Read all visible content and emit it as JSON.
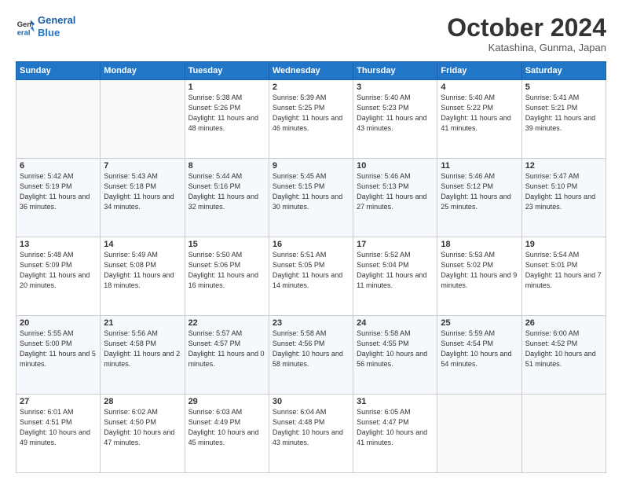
{
  "header": {
    "logo_line1": "General",
    "logo_line2": "Blue",
    "month": "October 2024",
    "location": "Katashina, Gunma, Japan"
  },
  "weekdays": [
    "Sunday",
    "Monday",
    "Tuesday",
    "Wednesday",
    "Thursday",
    "Friday",
    "Saturday"
  ],
  "weeks": [
    [
      {
        "day": "",
        "info": ""
      },
      {
        "day": "",
        "info": ""
      },
      {
        "day": "1",
        "info": "Sunrise: 5:38 AM\nSunset: 5:26 PM\nDaylight: 11 hours and 48 minutes."
      },
      {
        "day": "2",
        "info": "Sunrise: 5:39 AM\nSunset: 5:25 PM\nDaylight: 11 hours and 46 minutes."
      },
      {
        "day": "3",
        "info": "Sunrise: 5:40 AM\nSunset: 5:23 PM\nDaylight: 11 hours and 43 minutes."
      },
      {
        "day": "4",
        "info": "Sunrise: 5:40 AM\nSunset: 5:22 PM\nDaylight: 11 hours and 41 minutes."
      },
      {
        "day": "5",
        "info": "Sunrise: 5:41 AM\nSunset: 5:21 PM\nDaylight: 11 hours and 39 minutes."
      }
    ],
    [
      {
        "day": "6",
        "info": "Sunrise: 5:42 AM\nSunset: 5:19 PM\nDaylight: 11 hours and 36 minutes."
      },
      {
        "day": "7",
        "info": "Sunrise: 5:43 AM\nSunset: 5:18 PM\nDaylight: 11 hours and 34 minutes."
      },
      {
        "day": "8",
        "info": "Sunrise: 5:44 AM\nSunset: 5:16 PM\nDaylight: 11 hours and 32 minutes."
      },
      {
        "day": "9",
        "info": "Sunrise: 5:45 AM\nSunset: 5:15 PM\nDaylight: 11 hours and 30 minutes."
      },
      {
        "day": "10",
        "info": "Sunrise: 5:46 AM\nSunset: 5:13 PM\nDaylight: 11 hours and 27 minutes."
      },
      {
        "day": "11",
        "info": "Sunrise: 5:46 AM\nSunset: 5:12 PM\nDaylight: 11 hours and 25 minutes."
      },
      {
        "day": "12",
        "info": "Sunrise: 5:47 AM\nSunset: 5:10 PM\nDaylight: 11 hours and 23 minutes."
      }
    ],
    [
      {
        "day": "13",
        "info": "Sunrise: 5:48 AM\nSunset: 5:09 PM\nDaylight: 11 hours and 20 minutes."
      },
      {
        "day": "14",
        "info": "Sunrise: 5:49 AM\nSunset: 5:08 PM\nDaylight: 11 hours and 18 minutes."
      },
      {
        "day": "15",
        "info": "Sunrise: 5:50 AM\nSunset: 5:06 PM\nDaylight: 11 hours and 16 minutes."
      },
      {
        "day": "16",
        "info": "Sunrise: 5:51 AM\nSunset: 5:05 PM\nDaylight: 11 hours and 14 minutes."
      },
      {
        "day": "17",
        "info": "Sunrise: 5:52 AM\nSunset: 5:04 PM\nDaylight: 11 hours and 11 minutes."
      },
      {
        "day": "18",
        "info": "Sunrise: 5:53 AM\nSunset: 5:02 PM\nDaylight: 11 hours and 9 minutes."
      },
      {
        "day": "19",
        "info": "Sunrise: 5:54 AM\nSunset: 5:01 PM\nDaylight: 11 hours and 7 minutes."
      }
    ],
    [
      {
        "day": "20",
        "info": "Sunrise: 5:55 AM\nSunset: 5:00 PM\nDaylight: 11 hours and 5 minutes."
      },
      {
        "day": "21",
        "info": "Sunrise: 5:56 AM\nSunset: 4:58 PM\nDaylight: 11 hours and 2 minutes."
      },
      {
        "day": "22",
        "info": "Sunrise: 5:57 AM\nSunset: 4:57 PM\nDaylight: 11 hours and 0 minutes."
      },
      {
        "day": "23",
        "info": "Sunrise: 5:58 AM\nSunset: 4:56 PM\nDaylight: 10 hours and 58 minutes."
      },
      {
        "day": "24",
        "info": "Sunrise: 5:58 AM\nSunset: 4:55 PM\nDaylight: 10 hours and 56 minutes."
      },
      {
        "day": "25",
        "info": "Sunrise: 5:59 AM\nSunset: 4:54 PM\nDaylight: 10 hours and 54 minutes."
      },
      {
        "day": "26",
        "info": "Sunrise: 6:00 AM\nSunset: 4:52 PM\nDaylight: 10 hours and 51 minutes."
      }
    ],
    [
      {
        "day": "27",
        "info": "Sunrise: 6:01 AM\nSunset: 4:51 PM\nDaylight: 10 hours and 49 minutes."
      },
      {
        "day": "28",
        "info": "Sunrise: 6:02 AM\nSunset: 4:50 PM\nDaylight: 10 hours and 47 minutes."
      },
      {
        "day": "29",
        "info": "Sunrise: 6:03 AM\nSunset: 4:49 PM\nDaylight: 10 hours and 45 minutes."
      },
      {
        "day": "30",
        "info": "Sunrise: 6:04 AM\nSunset: 4:48 PM\nDaylight: 10 hours and 43 minutes."
      },
      {
        "day": "31",
        "info": "Sunrise: 6:05 AM\nSunset: 4:47 PM\nDaylight: 10 hours and 41 minutes."
      },
      {
        "day": "",
        "info": ""
      },
      {
        "day": "",
        "info": ""
      }
    ]
  ]
}
